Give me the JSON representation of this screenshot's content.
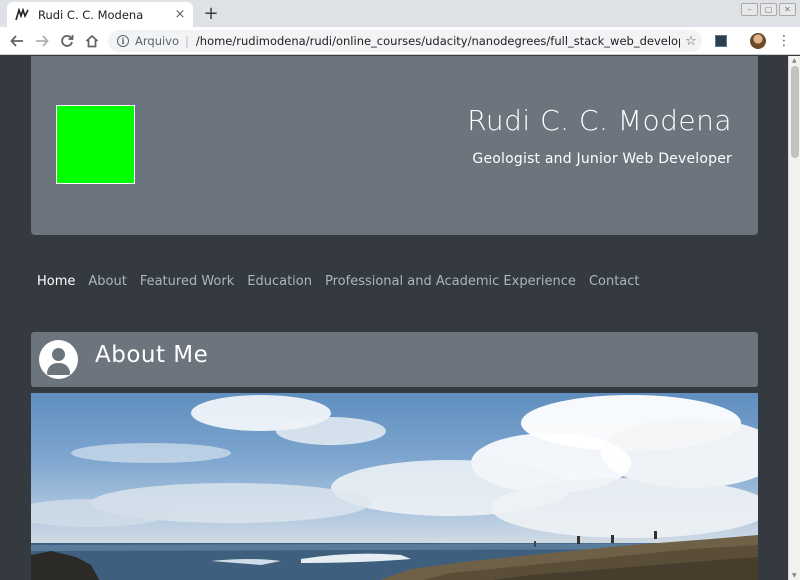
{
  "browser": {
    "tab_title": "Rudi C. C. Modena",
    "tab_close": "×",
    "new_tab": "+",
    "scheme_label": "Arquivo",
    "url": "/home/rudimodena/rudi/online_courses/udacity/nanodegrees/full_stack_web_developer/c...",
    "icons": [
      "back-icon",
      "forward-icon",
      "reload-icon",
      "home-icon",
      "info-icon",
      "star-icon",
      "extension-icon",
      "profile-icon",
      "menu-icon"
    ]
  },
  "header": {
    "logo_color": "#00ff00",
    "name": "Rudi C. C. Modena",
    "tagline": "Geologist and Junior Web Developer"
  },
  "nav": {
    "items": [
      {
        "label": "Home",
        "active": true
      },
      {
        "label": "About",
        "active": false
      },
      {
        "label": "Featured Work",
        "active": false
      },
      {
        "label": "Education",
        "active": false
      },
      {
        "label": "Professional and Academic Experience",
        "active": false
      },
      {
        "label": "Contact",
        "active": false
      }
    ]
  },
  "about": {
    "title": "About Me",
    "icon": "user-icon"
  },
  "colors": {
    "page_bg": "#343a40",
    "panel_bg": "#6c757d",
    "nav_inactive": "#adb5bd",
    "text": "#ffffff"
  }
}
